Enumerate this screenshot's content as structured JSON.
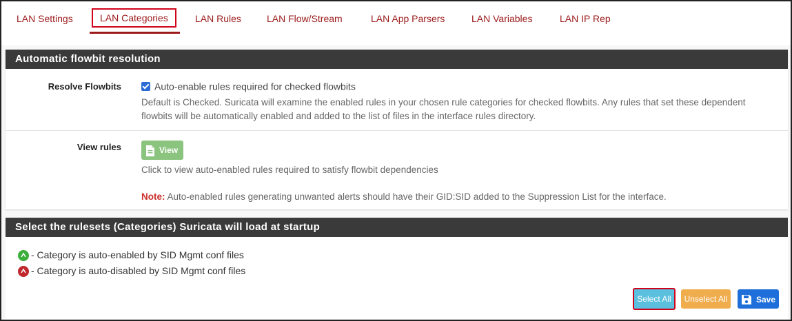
{
  "tabs": [
    {
      "label": "LAN Settings"
    },
    {
      "label": "LAN Categories"
    },
    {
      "label": "LAN Rules"
    },
    {
      "label": "LAN Flow/Stream"
    },
    {
      "label": "LAN App Parsers"
    },
    {
      "label": "LAN Variables"
    },
    {
      "label": "LAN IP Rep"
    }
  ],
  "active_tab": "LAN Categories",
  "flowbit": {
    "title": "Automatic flowbit resolution",
    "resolve_label": "Resolve Flowbits",
    "checkbox_label": "Auto-enable rules required for checked flowbits",
    "checkbox_checked": true,
    "help_line1": "Default is Checked. Suricata will examine the enabled rules in your chosen rule categories for checked flowbits. Any rules that set these dependent",
    "help_line2": "flowbits will be automatically enabled and added to the list of files in the interface rules directory.",
    "view_label": "View rules",
    "view_button": "View",
    "view_help": "Click to view auto-enabled rules required to satisfy flowbit dependencies",
    "note_label": "Note:",
    "note_text": "Auto-enabled rules generating unwanted alerts should have their GID:SID added to the Suppression List for the interface."
  },
  "rulesets": {
    "title": "Select the rulesets (Categories) Suricata will load at startup",
    "legend_enabled": "- Category is auto-enabled by SID Mgmt conf files",
    "legend_disabled": "- Category is auto-disabled by SID Mgmt conf files",
    "select_all": "Select All",
    "unselect_all": "Unselect All",
    "save": "Save"
  },
  "colors": {
    "tab_text": "#9c1a1a",
    "highlight": "#d0021b",
    "header_bg": "#3a3a3a",
    "select_all_bg": "#5bc0de",
    "unselect_all_bg": "#f0ad4e",
    "save_bg": "#1e6fd9",
    "view_bg": "#8bc47e",
    "enabled_icon": "#3cae3c",
    "disabled_icon": "#c0282d"
  }
}
